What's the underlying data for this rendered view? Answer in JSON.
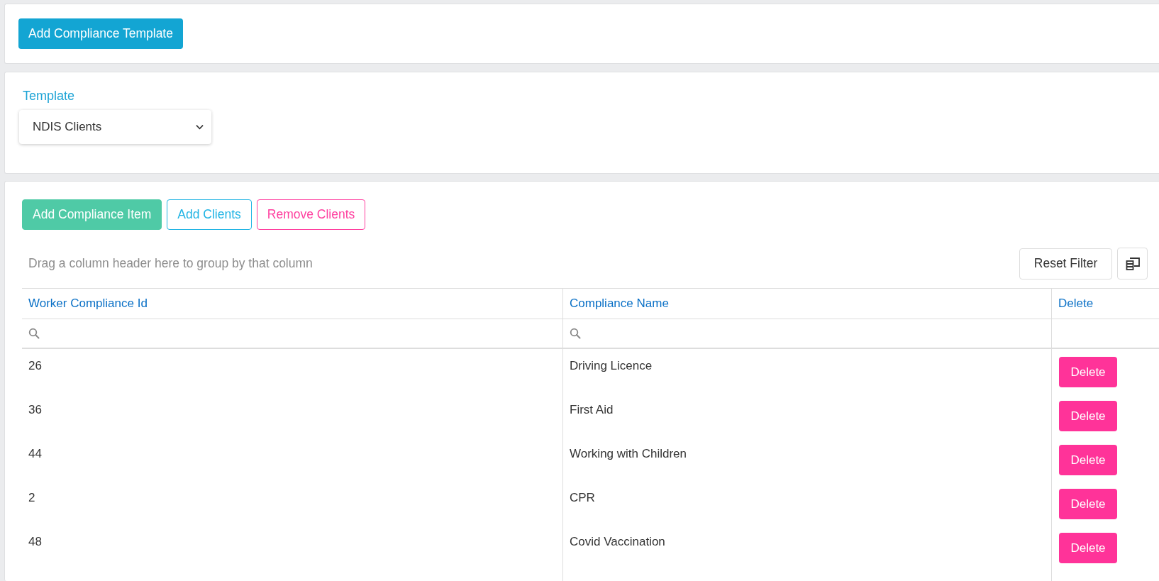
{
  "top_panel": {
    "add_template_button": "Add Compliance Template"
  },
  "template_panel": {
    "label": "Template",
    "select_value": "NDIS Clients"
  },
  "grid_panel": {
    "actions": [
      {
        "label": "Add Compliance Item",
        "kind": "filled",
        "color": "#4fcaa6"
      },
      {
        "label": "Add Clients",
        "kind": "outline",
        "color": "#21b4e4"
      },
      {
        "label": "Remove Clients",
        "kind": "outline",
        "color": "#ff3f9f"
      }
    ],
    "group_panel_hint": "Drag a column header here to group by that column",
    "reset_filter_button": "Reset Filter",
    "columns": [
      {
        "title": "Worker Compliance Id",
        "filterable": true
      },
      {
        "title": "Compliance Name",
        "filterable": true
      },
      {
        "title": "Delete",
        "filterable": false
      }
    ],
    "rows": [
      {
        "cells": [
          "26",
          "Driving Licence"
        ],
        "button": "Delete"
      },
      {
        "cells": [
          "36",
          "First Aid"
        ],
        "button": "Delete"
      },
      {
        "cells": [
          "44",
          "Working with Children"
        ],
        "button": "Delete"
      },
      {
        "cells": [
          "2",
          "CPR"
        ],
        "button": "Delete"
      },
      {
        "cells": [
          "48",
          "Covid Vaccination"
        ],
        "button": "Delete"
      }
    ]
  }
}
